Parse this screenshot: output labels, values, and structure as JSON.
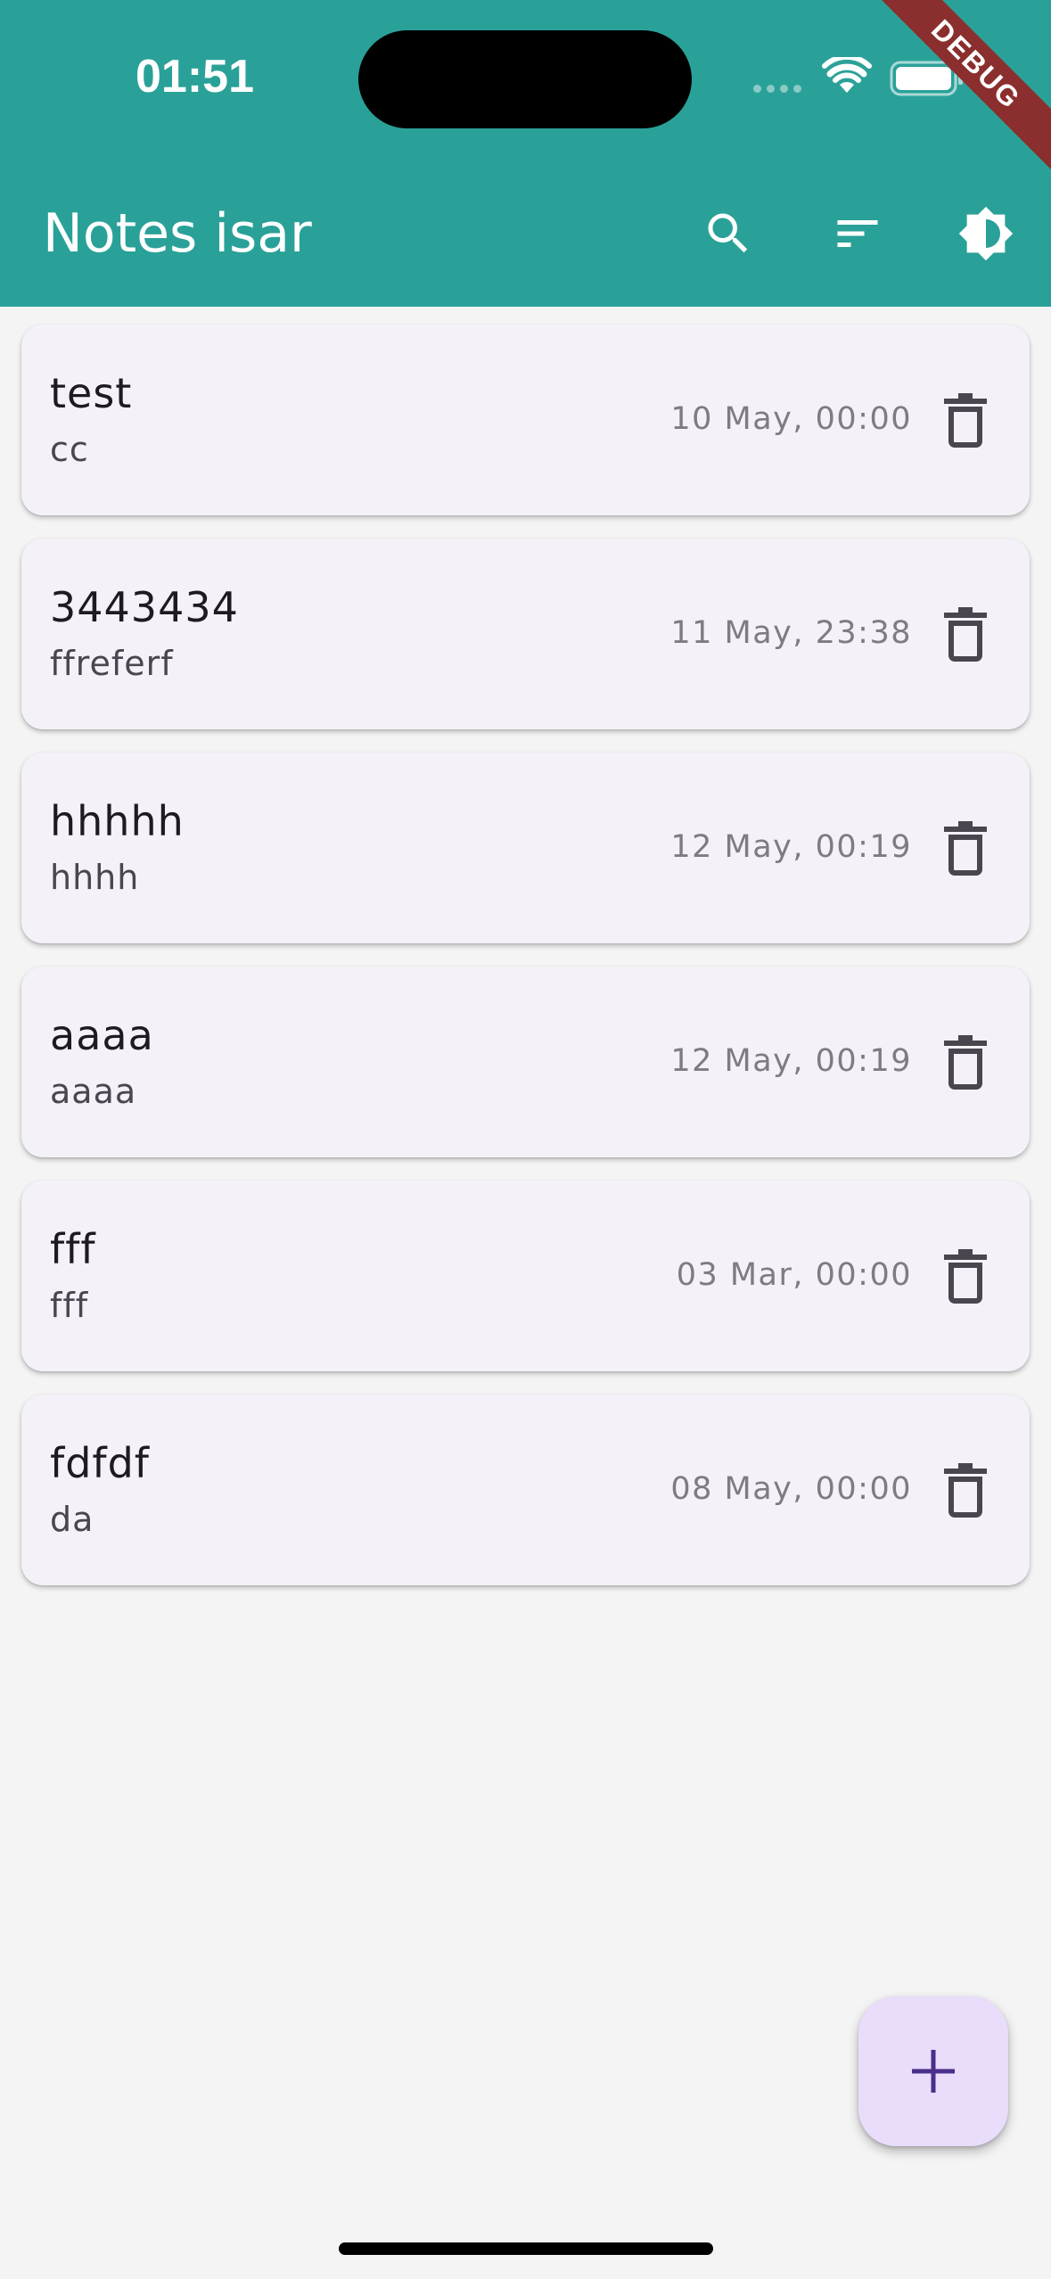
{
  "status_bar": {
    "time": "01:51"
  },
  "debug_banner": "DEBUG",
  "app_bar": {
    "title": "Notes isar",
    "actions": [
      {
        "icon": "search-icon"
      },
      {
        "icon": "sort-icon"
      },
      {
        "icon": "brightness-icon"
      }
    ],
    "background_color": "#2aa198"
  },
  "notes": [
    {
      "title": "test",
      "body": "cc",
      "date": "10 May, 00:00"
    },
    {
      "title": "3443434",
      "body": "ffreferf",
      "date": "11 May, 23:38"
    },
    {
      "title": "hhhhh",
      "body": "hhhh",
      "date": "12 May, 00:19"
    },
    {
      "title": "aaaa",
      "body": "aaaa",
      "date": "12 May, 00:19"
    },
    {
      "title": "fff",
      "body": "fff",
      "date": "03 Mar, 00:00"
    },
    {
      "title": "fdfdf",
      "body": "da",
      "date": "08 May, 00:00"
    }
  ],
  "fab": {
    "icon": "plus-icon",
    "color": "#e9ddfb",
    "icon_color": "#4a2e8a"
  }
}
